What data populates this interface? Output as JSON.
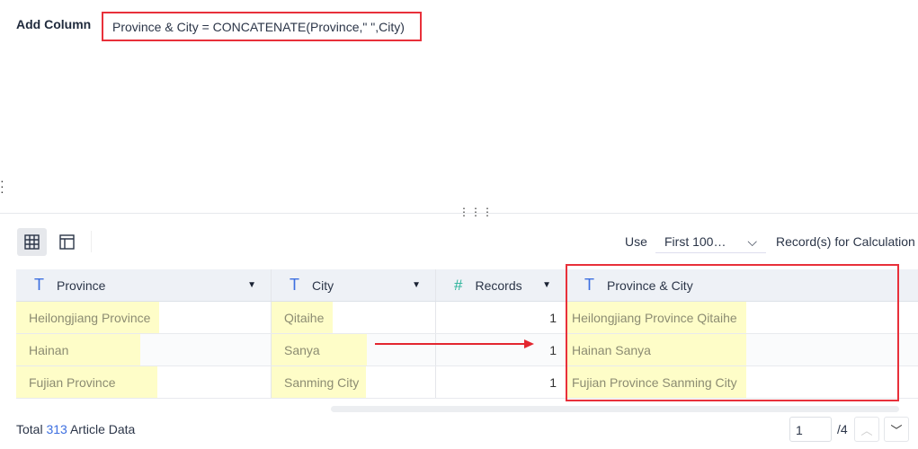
{
  "add_column": {
    "label": "Add Column",
    "formula": "Province & City = CONCATENATE(Province,\" \",City)"
  },
  "toolbar": {
    "use_label": "Use",
    "sample_select": "First 100…",
    "records_label": "Record(s) for Calculation"
  },
  "table": {
    "columns": [
      {
        "name": "Province",
        "type": "text"
      },
      {
        "name": "City",
        "type": "text"
      },
      {
        "name": "Records",
        "type": "number"
      },
      {
        "name": "Province & City",
        "type": "text"
      }
    ],
    "rows": [
      [
        "Heilongjiang Province",
        "Qitaihe",
        "1",
        "Heilongjiang Province Qitaihe"
      ],
      [
        "Hainan",
        "Sanya",
        "1",
        "Hainan Sanya"
      ],
      [
        "Fujian Province",
        "Sanming City",
        "1",
        "Fujian Province Sanming City"
      ]
    ]
  },
  "footer": {
    "total_prefix": "Total",
    "total_count": "313",
    "total_suffix": "Article Data",
    "page": "1",
    "page_of": "/4"
  },
  "colors": {
    "accent": "#3d6fe0",
    "highlight": "#e8303a",
    "cell_highlight": "#fefdc8"
  }
}
